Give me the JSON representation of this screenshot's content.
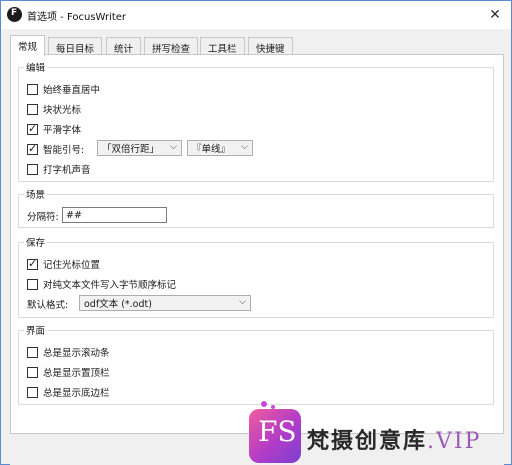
{
  "window": {
    "title": "首选项 - FocusWriter",
    "close_glyph": "✕"
  },
  "tabs": [
    "常规",
    "每日目标",
    "统计",
    "拼写检查",
    "工具栏",
    "快捷键"
  ],
  "groups": {
    "editing": {
      "title": "编辑",
      "items": [
        {
          "label": "始终垂直居中",
          "checked": false
        },
        {
          "label": "块状光标",
          "checked": false
        },
        {
          "label": "平滑字体",
          "checked": true
        },
        {
          "label": "智能引号:",
          "checked": true
        },
        {
          "label": "打字机声音",
          "checked": false
        }
      ],
      "double_quotes": "「双倍行距」",
      "single_quotes": "『单线』"
    },
    "scenes": {
      "title": "场景",
      "divider_label": "分隔符:",
      "divider_value": "##"
    },
    "saving": {
      "title": "保存",
      "items": [
        {
          "label": "记住光标位置",
          "checked": true
        },
        {
          "label": "对纯文本文件写入字节顺序标记",
          "checked": false
        }
      ],
      "format_label": "默认格式:",
      "format_value": "odf文本 (*.odt)"
    },
    "interface": {
      "title": "界面",
      "items": [
        {
          "label": "总是显示滚动条",
          "checked": false
        },
        {
          "label": "总是显示置顶栏",
          "checked": false
        },
        {
          "label": "总是显示底边栏",
          "checked": false
        }
      ]
    }
  },
  "watermark": {
    "logo": "FS",
    "text": "梵摄创意库",
    "suffix": ".VIP"
  }
}
